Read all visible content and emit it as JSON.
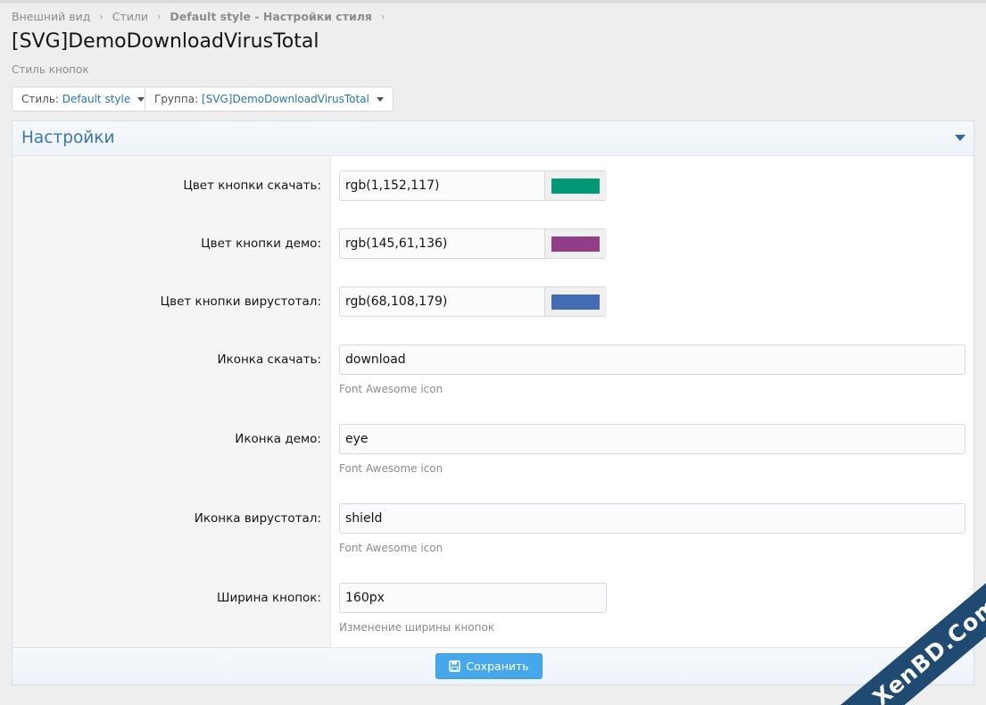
{
  "breadcrumb": {
    "items": [
      "Внешний вид",
      "Стили",
      "Default style - Настройки стиля"
    ]
  },
  "page": {
    "title": "[SVG]DemoDownloadVirusTotal",
    "description": "Стиль кнопок"
  },
  "filters": {
    "style_label": "Стиль:",
    "style_value": "Default style",
    "group_label": "Группа:",
    "group_value": "[SVG]DemoDownloadVirusTotal"
  },
  "panel": {
    "title": "Настройки"
  },
  "fields": {
    "download_color": {
      "label": "Цвет кнопки скачать:",
      "value": "rgb(1,152,117)",
      "swatch": "#019875"
    },
    "demo_color": {
      "label": "Цвет кнопки демо:",
      "value": "rgb(145,61,136)",
      "swatch": "#913d88"
    },
    "virustotal_color": {
      "label": "Цвет кнопки вирустотал:",
      "value": "rgb(68,108,179)",
      "swatch": "#446cb3"
    },
    "download_icon": {
      "label": "Иконка скачать:",
      "value": "download",
      "hint": "Font Awesome icon"
    },
    "demo_icon": {
      "label": "Иконка демо:",
      "value": "eye",
      "hint": "Font Awesome icon"
    },
    "virustotal_icon": {
      "label": "Иконка вирустотал:",
      "value": "shield",
      "hint": "Font Awesome icon"
    },
    "button_width": {
      "label": "Ширина кнопок:",
      "value": "160px",
      "hint": "Изменение ширины кнопок"
    }
  },
  "footer": {
    "save_label": "Сохранить"
  },
  "watermark": {
    "text": "XenBD.Com"
  },
  "colors": {
    "accent": "#47a7eb",
    "panel_title": "#3a76a8",
    "link": "#2577b1"
  }
}
